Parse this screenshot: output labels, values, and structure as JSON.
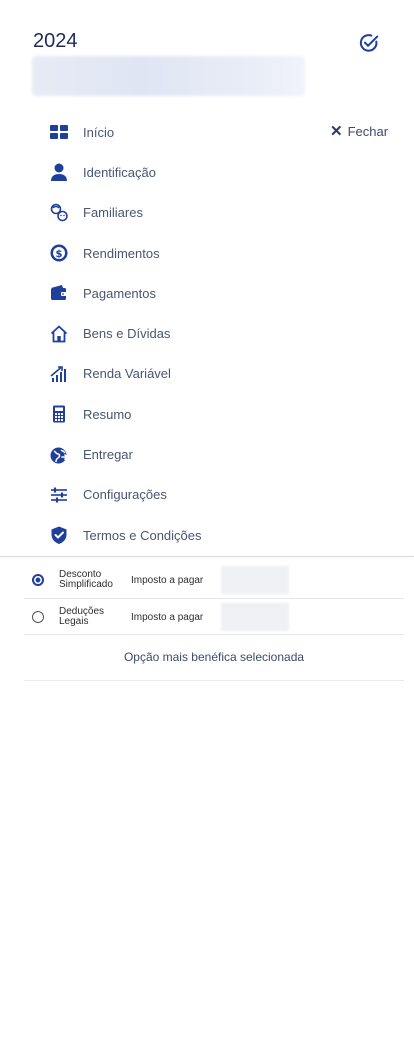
{
  "header": {
    "year": "2024",
    "close_label": "Fechar"
  },
  "menu": [
    {
      "label": "Início",
      "icon": "grid-icon"
    },
    {
      "label": "Identificação",
      "icon": "person-icon"
    },
    {
      "label": "Familiares",
      "icon": "family-icon"
    },
    {
      "label": "Rendimentos",
      "icon": "dollar-coin-icon"
    },
    {
      "label": "Pagamentos",
      "icon": "wallet-icon"
    },
    {
      "label": "Bens e Dívidas",
      "icon": "house-icon"
    },
    {
      "label": "Renda Variável",
      "icon": "growth-chart-icon"
    },
    {
      "label": "Resumo",
      "icon": "calculator-icon"
    },
    {
      "label": "Entregar",
      "icon": "globe-send-icon"
    },
    {
      "label": "Configurações",
      "icon": "sliders-icon"
    },
    {
      "label": "Termos e Condições",
      "icon": "shield-check-icon"
    }
  ],
  "options": [
    {
      "name_line1": "Desconto",
      "name_line2": "Simplificado",
      "tax_label": "Imposto a pagar",
      "selected": true
    },
    {
      "name_line1": "Deduções",
      "name_line2": "Legais",
      "tax_label": "Imposto a pagar",
      "selected": false
    }
  ],
  "best_option_text": "Opção mais benéfica selecionada",
  "colors": {
    "primary": "#1f3f9c",
    "text": "#4a5573"
  }
}
